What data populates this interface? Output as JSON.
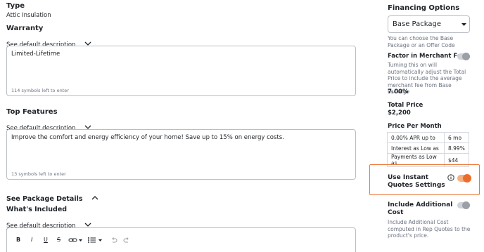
{
  "type_section": {
    "heading": "Type",
    "value": "Attic Insulation"
  },
  "warranty": {
    "heading": "Warranty",
    "see_default": "See default description",
    "text": "Limited-Lifetime",
    "counter": "114 symbols left to enter"
  },
  "top_features": {
    "heading": "Top Features",
    "see_default": "See default description",
    "text": "Improve the comfort and energy efficiency of your home! Save up to 15% on energy costs.",
    "counter": "13 symbols left to enter"
  },
  "package_details": {
    "label": "See Package Details"
  },
  "whats_included": {
    "heading": "What's Included",
    "see_default": "See default description",
    "toolbar": {
      "bold": "B",
      "italic": "I",
      "underline": "U",
      "strike": "S"
    }
  },
  "financing": {
    "heading": "Financing Options",
    "selected": "Base Package",
    "hint": "You can choose the Base Package or an Offer Code"
  },
  "merchant_fee": {
    "label": "Factor in Merchant Fee",
    "enabled": false,
    "description": "Turning this on will automatically adjust the Total Price to include the average merchant fee from Base Package",
    "value": "7.00%"
  },
  "total_price": {
    "label": "Total Price",
    "value": "$2,200"
  },
  "price_per_month": {
    "label": "Price Per Month",
    "rows": [
      {
        "name": "0.00% APR up to",
        "value": "6 mo"
      },
      {
        "name": "Interest as Low as",
        "value": "8.99%"
      },
      {
        "name": "Payments as Low as",
        "value": "$44"
      }
    ]
  },
  "instant_quotes": {
    "label": "Use Instant Quotes Settings",
    "enabled": true
  },
  "additional_cost": {
    "label": "Include Additional Cost",
    "enabled": false,
    "description": "Include Additional Cost computed in Rep Quotes to the product's price."
  },
  "colors": {
    "accent": "#ec6d2a",
    "highlight_border": "#ec7a3c",
    "border": "#b9bec6",
    "muted_text": "#6b7280"
  }
}
